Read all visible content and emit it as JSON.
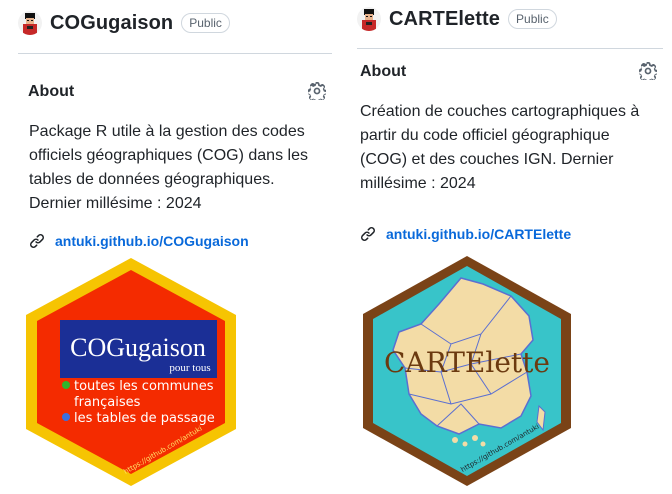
{
  "repos": [
    {
      "name": "COGugaison",
      "visibility": "Public",
      "about_title": "About",
      "description": "Package R utile à la gestion des codes officiels géographiques (COG) dans les tables de données géographiques. Dernier millésime : 2024",
      "homepage": "antuki.github.io/COGugaison",
      "logo": {
        "title": "COGugaison",
        "subtitle": "pour tous",
        "bullets": [
          "toutes les communes",
          "françaises",
          "les tables de passage"
        ],
        "url": "https://github.com/antuki",
        "colors": {
          "border": "#f6c402",
          "fill": "#f42b00",
          "title_box": "#1b2f96",
          "bullet_green": "#2eb62c",
          "bullet_blue": "#3b6fe0"
        }
      }
    },
    {
      "name": "CARTElette",
      "visibility": "Public",
      "about_title": "About",
      "description": "Création de couches cartographiques à partir du code officiel géographique (COG) et des couches IGN. Dernier millésime : 2024",
      "homepage": "antuki.github.io/CARTElette",
      "logo": {
        "title": "CARTElette",
        "url": "https://github.com/antuki",
        "colors": {
          "border": "#7a4317",
          "fill": "#38c4c9",
          "map": "#f3dca6",
          "map_lines": "#5b6fd1",
          "title": "#6b3a10"
        }
      }
    }
  ],
  "icons": [
    "avatar-icon",
    "gear-icon",
    "link-icon"
  ]
}
